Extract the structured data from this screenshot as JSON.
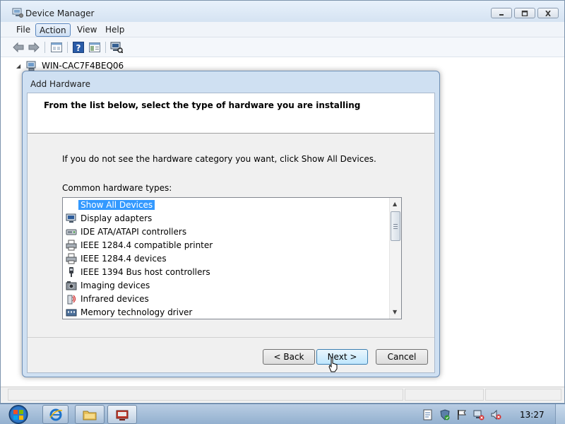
{
  "window": {
    "title": "Device Manager",
    "icon": "device-manager-icon"
  },
  "menu": {
    "items": [
      {
        "label": "File"
      },
      {
        "label": "Action",
        "active": true
      },
      {
        "label": "View"
      },
      {
        "label": "Help"
      }
    ]
  },
  "toolbar": {
    "icons": [
      "back-arrow-icon",
      "forward-arrow-icon",
      "properties-icon",
      "help-icon",
      "console-tree-icon",
      "scan-hardware-icon"
    ]
  },
  "tree": {
    "root_label": "WIN-CAC7F4BEQ06",
    "expander": "◢"
  },
  "dialog": {
    "title": "Add Hardware",
    "header": "From the list below, select the type of hardware you are installing",
    "instruction": "If you do not see the hardware category you want, click Show All Devices.",
    "list_label": "Common hardware types:",
    "list_items": [
      {
        "label": "Show All Devices",
        "icon": "none",
        "selected": true
      },
      {
        "label": "Display adapters",
        "icon": "monitor-icon"
      },
      {
        "label": "IDE ATA/ATAPI controllers",
        "icon": "ide-controller-icon"
      },
      {
        "label": "IEEE 1284.4 compatible printer",
        "icon": "printer-icon"
      },
      {
        "label": "IEEE 1284.4 devices",
        "icon": "printer-icon"
      },
      {
        "label": "IEEE 1394 Bus host controllers",
        "icon": "firewire-icon"
      },
      {
        "label": "Imaging devices",
        "icon": "camera-icon"
      },
      {
        "label": "Infrared devices",
        "icon": "infrared-icon"
      },
      {
        "label": "Memory technology driver",
        "icon": "memory-icon"
      }
    ],
    "buttons": {
      "back": "< Back",
      "next": "Next >",
      "cancel": "Cancel"
    }
  },
  "taskbar": {
    "apps": [
      "internet-explorer-icon",
      "windows-explorer-icon",
      "device-manager-taskbar-icon"
    ],
    "tray_icons": [
      "document-icon",
      "shield-icon",
      "flag-icon",
      "network-icon",
      "volume-muted-icon"
    ],
    "clock": "13:27"
  },
  "colors": {
    "selection": "#3399ff",
    "titlebar": "#d5e3f2",
    "taskbar": "#93b0cf"
  }
}
